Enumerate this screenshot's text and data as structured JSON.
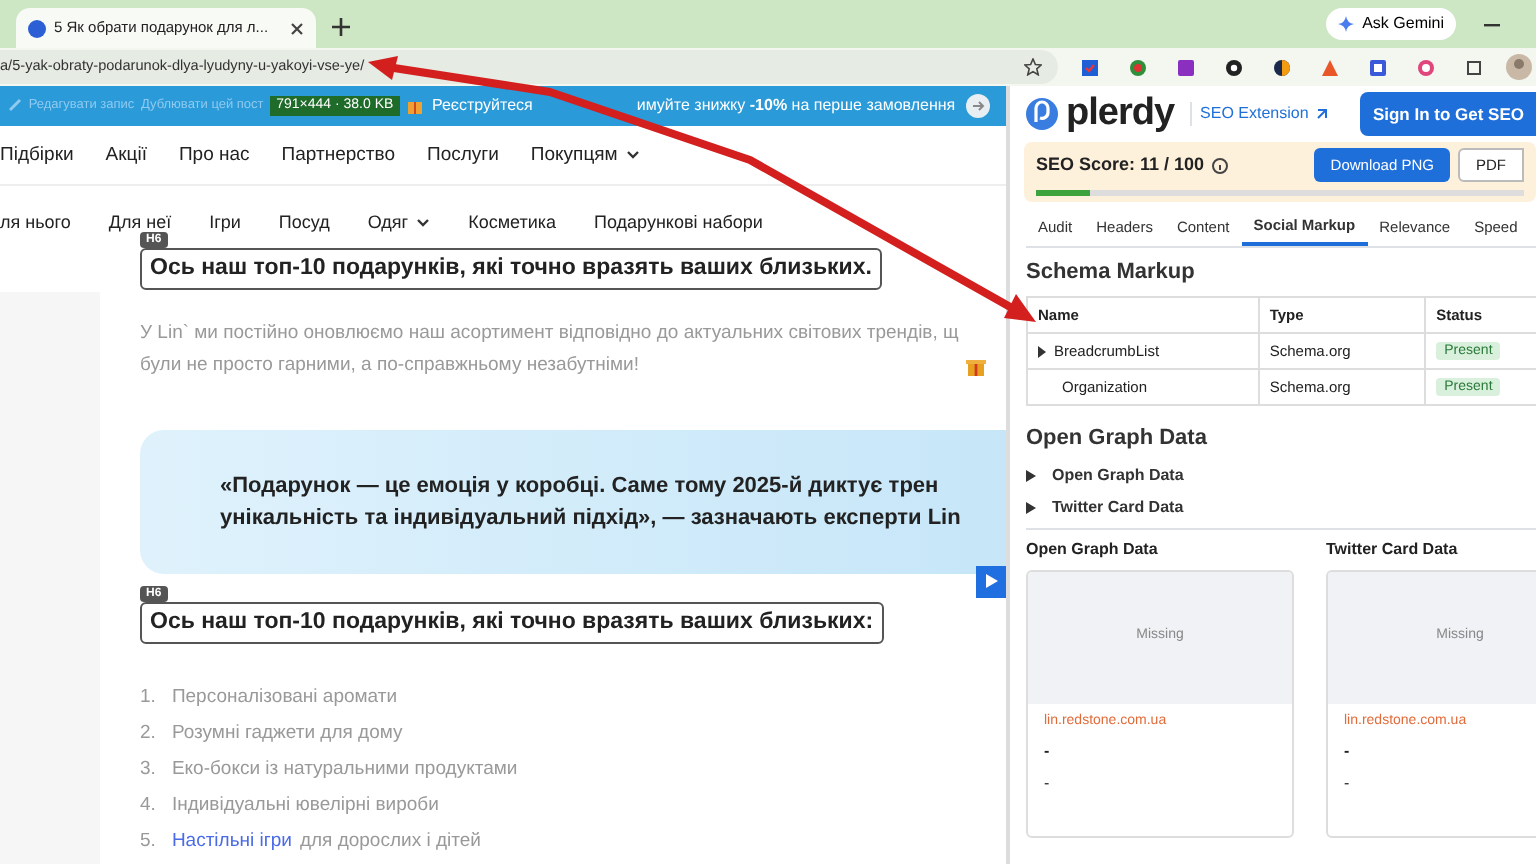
{
  "browser": {
    "tab_title": "5 Як обрати подарунок для л...",
    "url": "a/5-yak-obraty-podarunok-dlya-lyudyny-u-yakoyi-vse-ye/",
    "gemini_button": "Ask Gemini"
  },
  "admin_bar": {
    "items": [
      "Редагувати запис",
      "Дублювати цей пост"
    ],
    "image_info": "791×444 · 38.0 KB"
  },
  "promo_banner": [
    "Реєструйтеся",
    "имуйте знижку **-10%** на перше замовлення"
  ],
  "main_nav": [
    {
      "label": "Підбірки",
      "dropdown": false
    },
    {
      "label": "Акції",
      "dropdown": false
    },
    {
      "label": "Про нас",
      "dropdown": false
    },
    {
      "label": "Партнерство",
      "dropdown": false
    },
    {
      "label": "Послуги",
      "dropdown": false
    },
    {
      "label": "Покупцям",
      "dropdown": true
    }
  ],
  "category_nav": [
    {
      "label": "ля нього",
      "dropdown": false
    },
    {
      "label": "Для неї",
      "dropdown": false
    },
    {
      "label": "Ігри",
      "dropdown": false
    },
    {
      "label": "Посуд",
      "dropdown": false
    },
    {
      "label": "Одяг",
      "dropdown": true
    },
    {
      "label": "Косметика",
      "dropdown": false
    },
    {
      "label": "Подарункові набори",
      "dropdown": false
    }
  ],
  "article": {
    "blocks": [
      {
        "kind": "heading",
        "badge": "H6",
        "text": "Ось наш топ-10 подарунків, які точно вразять ваших близьких."
      },
      {
        "kind": "paragraph",
        "lines": [
          "У Lin` ми постійно оновлюємо наш асортимент відповідно до актуальних світових трендів, щ",
          "були не просто гарними, а по-справжньому незабутніми!"
        ]
      },
      {
        "kind": "quote",
        "lines": [
          "«Подарунок — це емоція у коробці. Саме тому 2025-й диктує трен",
          "унікальність та індивідуальний підхід», — зазначають експерти Lin"
        ]
      },
      {
        "kind": "heading",
        "badge": "H6",
        "text": "Ось наш топ-10 подарунків, які точно вразять ваших близьких:"
      },
      {
        "kind": "list",
        "items": [
          {
            "number": "1.",
            "text": "Персоналізовані аромати"
          },
          {
            "number": "2.",
            "text": "Розумні гаджети для дому"
          },
          {
            "number": "3.",
            "text": "Еко-бокси із натуральними продуктами"
          },
          {
            "number": "4.",
            "text": "Індивідуальні ювелірні вироби"
          },
          {
            "number": "5.",
            "link": "Настільні ігри",
            "text": "для дорослих і дітей"
          }
        ]
      }
    ]
  },
  "seo_panel": {
    "brand": "plerdy",
    "extension_link": "SEO Extension",
    "sign_in_button": "Sign In to Get SEO",
    "score": {
      "label": "SEO Score: 11 / 100",
      "level": 0.11,
      "buttons": [
        "Download PNG",
        "PDF"
      ]
    },
    "tabs": [
      {
        "label": "Audit",
        "selected": false
      },
      {
        "label": "Headers",
        "selected": false
      },
      {
        "label": "Content",
        "selected": false
      },
      {
        "label": "Social Markup",
        "selected": true
      },
      {
        "label": "Relevance",
        "selected": false
      },
      {
        "label": "Speed",
        "selected": false
      }
    ],
    "schema": {
      "title": "Schema Markup",
      "columns": [
        "Name",
        "Type",
        "Status"
      ],
      "rows": [
        {
          "name": "BreadcrumbList",
          "type": "Schema.org",
          "status": "Present",
          "expandable": true
        },
        {
          "name": "Organization",
          "type": "Schema.org",
          "status": "Present",
          "expandable": false
        }
      ]
    },
    "open_graph": {
      "title": "Open Graph Data",
      "sections": [
        {
          "label": "Open Graph Data",
          "expanded": false
        },
        {
          "label": "Twitter Card Data",
          "expanded": false
        }
      ]
    },
    "previews": [
      {
        "title": "Open Graph Data",
        "image": "Missing",
        "domain": "lin.redstone.com.ua",
        "headline": "-",
        "description": "-"
      },
      {
        "title": "Twitter Card Data",
        "image": "Missing",
        "domain": "lin.redstone.com.ua",
        "headline": "-",
        "description": "-"
      }
    ]
  }
}
